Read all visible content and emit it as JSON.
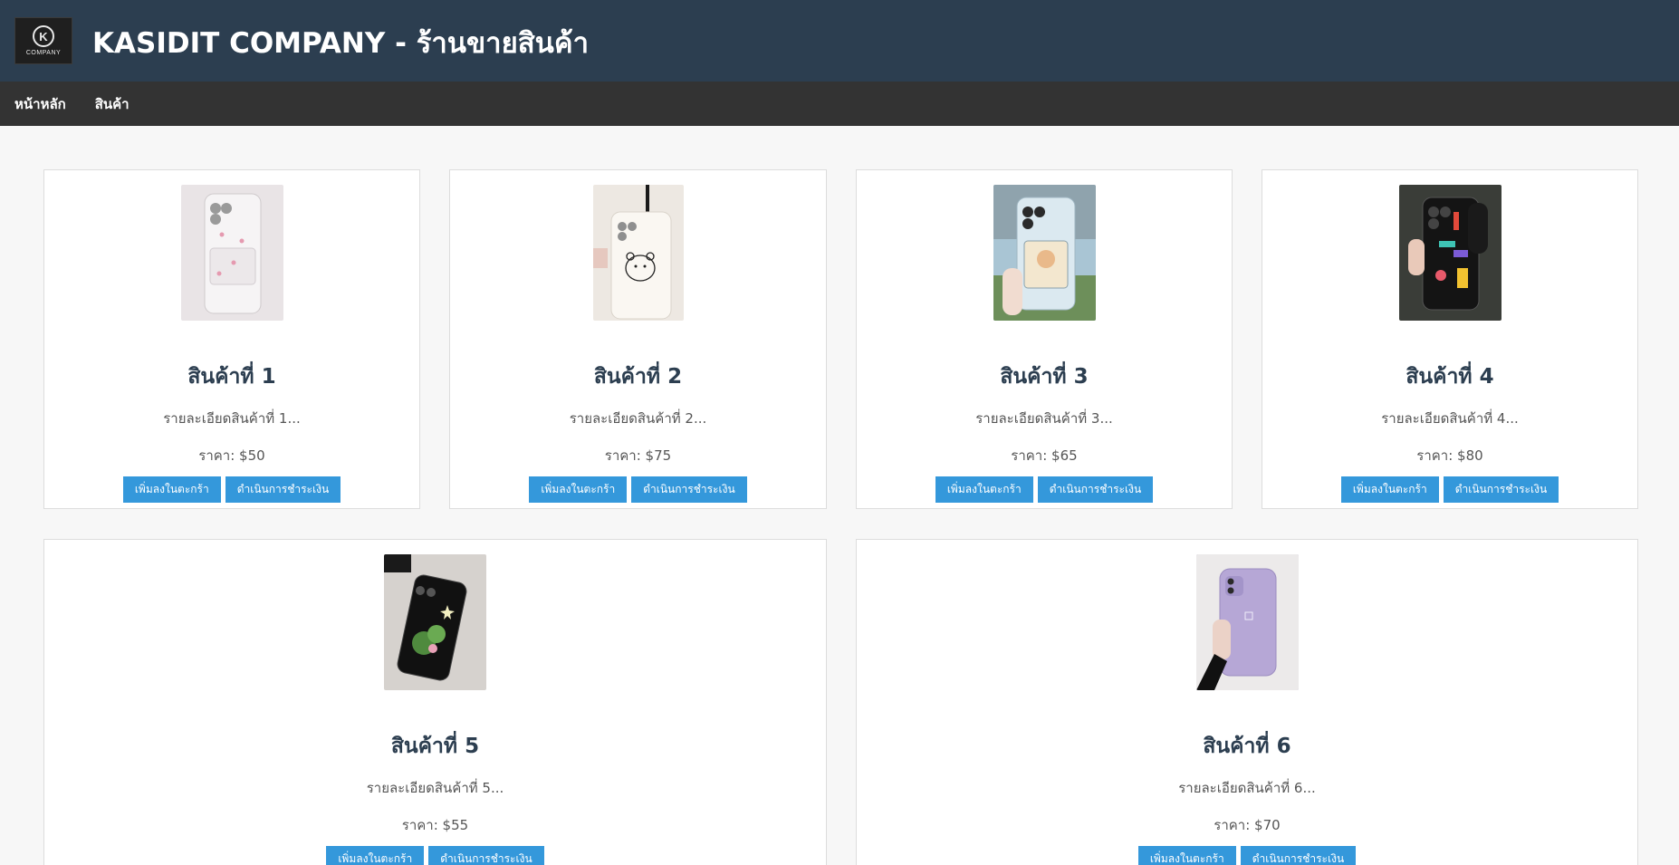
{
  "header": {
    "logo_text": "COMPANY",
    "logo_letter": "K",
    "title": "KASIDIT COMPANY - ร้านขายสินค้า"
  },
  "nav": {
    "items": [
      {
        "label": "หน้าหลัก"
      },
      {
        "label": "สินค้า"
      }
    ]
  },
  "products": [
    {
      "title": "สินค้าที่ 1",
      "description": "รายละเอียดสินค้าที่ 1...",
      "price": "ราคา: $50",
      "add_to_cart": "เพิ่มลงในตะกร้า",
      "checkout": "ดำเนินการชำระเงิน",
      "image_color": "#e9e4e6"
    },
    {
      "title": "สินค้าที่ 2",
      "description": "รายละเอียดสินค้าที่ 2...",
      "price": "ราคา: $75",
      "add_to_cart": "เพิ่มลงในตะกร้า",
      "checkout": "ดำเนินการชำระเงิน",
      "image_color": "#ede8e2"
    },
    {
      "title": "สินค้าที่ 3",
      "description": "รายละเอียดสินค้าที่ 3...",
      "price": "ราคา: $65",
      "add_to_cart": "เพิ่มลงในตะกร้า",
      "checkout": "ดำเนินการชำระเงิน",
      "image_color": "#a9c5d4"
    },
    {
      "title": "สินค้าที่ 4",
      "description": "รายละเอียดสินค้าที่ 4...",
      "price": "ราคา: $80",
      "add_to_cart": "เพิ่มลงในตะกร้า",
      "checkout": "ดำเนินการชำระเงิน",
      "image_color": "#3a3d38"
    },
    {
      "title": "สินค้าที่ 5",
      "description": "รายละเอียดสินค้าที่ 5...",
      "price": "ราคา: $55",
      "add_to_cart": "เพิ่มลงในตะกร้า",
      "checkout": "ดำเนินการชำระเงิน",
      "image_color": "#d6d2ce"
    },
    {
      "title": "สินค้าที่ 6",
      "description": "รายละเอียดสินค้าที่ 6...",
      "price": "ราคา: $70",
      "add_to_cart": "เพิ่มลงในตะกร้า",
      "checkout": "ดำเนินการชำระเงิน",
      "image_color": "#b6a7d6"
    }
  ]
}
